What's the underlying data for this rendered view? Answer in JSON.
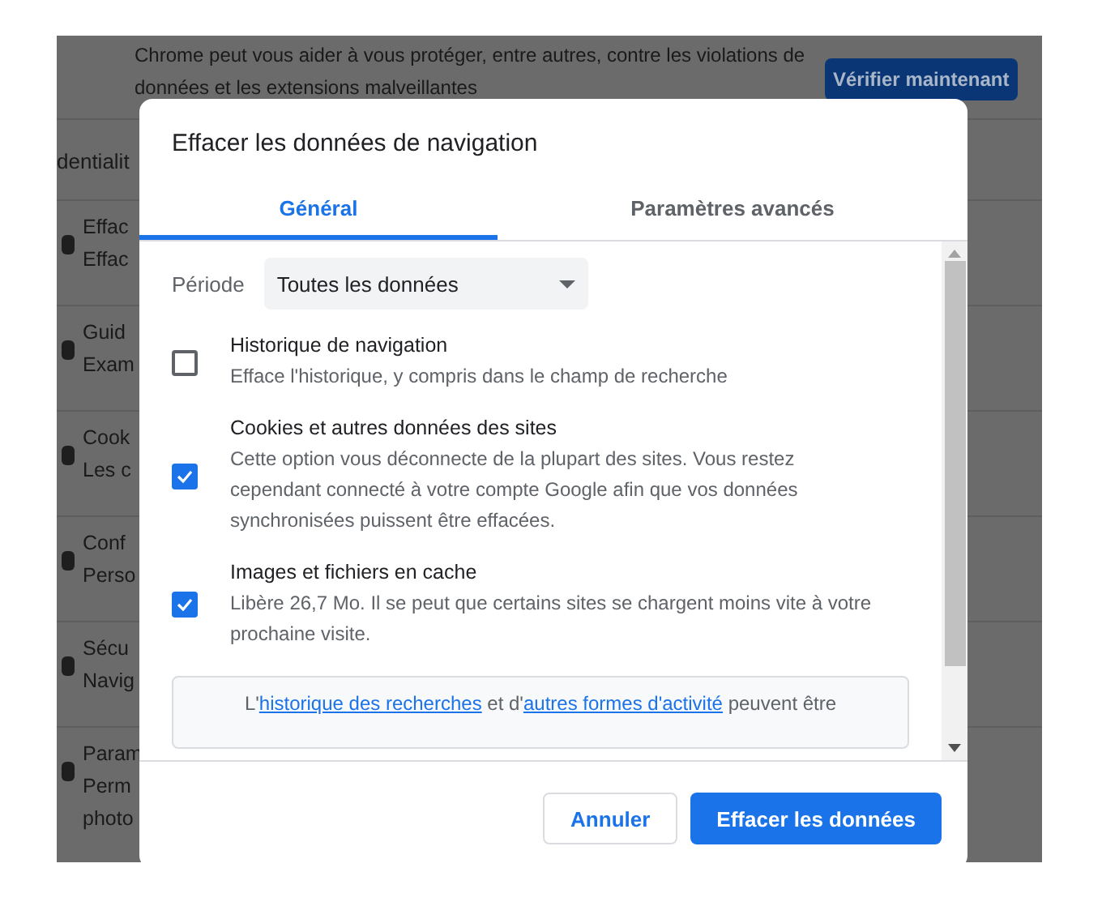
{
  "background": {
    "notice": [
      "Chrome peut vous aider à vous protéger, entre autres, contre les violations de",
      "données et les extensions malveillantes"
    ],
    "check_button": "Vérifier maintenant",
    "section_heading": "dentialit",
    "items": [
      {
        "title": "Effac",
        "subtitle": "Effac"
      },
      {
        "title": "Guid",
        "subtitle": "Exam"
      },
      {
        "title": "Cook",
        "subtitle": "Les c"
      },
      {
        "title": "Conf",
        "subtitle": "Perso"
      },
      {
        "title": "Sécu",
        "subtitle": "Navig"
      },
      {
        "title": "Param",
        "subtitle": "Perm",
        "extra": "photo"
      }
    ]
  },
  "dialog": {
    "title": "Effacer les données de navigation",
    "tabs": [
      {
        "label": "Général",
        "selected": true
      },
      {
        "label": "Paramètres avancés",
        "selected": false
      }
    ],
    "period": {
      "label": "Période",
      "value": "Toutes les données"
    },
    "options": [
      {
        "title": "Historique de navigation",
        "description": "Efface l'historique, y compris dans le champ de recherche",
        "checked": false
      },
      {
        "title": "Cookies et autres données des sites",
        "description": "Cette option vous déconnecte de la plupart des sites. Vous restez cependant connecté à votre compte Google afin que vos données synchronisées puissent être effacées.",
        "checked": true
      },
      {
        "title": "Images et fichiers en cache",
        "description": "Libère 26,7 Mo. Il se peut que certains sites se chargent moins vite à votre prochaine visite.",
        "checked": true
      }
    ],
    "notice": [
      {
        "kind": "text",
        "text": "L'"
      },
      {
        "kind": "link",
        "text": "historique des recherches"
      },
      {
        "kind": "text",
        "text": " et d'"
      },
      {
        "kind": "link",
        "text": "autres formes d'activité"
      },
      {
        "kind": "text",
        "text": " peuvent être"
      }
    ],
    "buttons": [
      {
        "label": "Annuler",
        "kind": "secondary"
      },
      {
        "label": "Effacer les données",
        "kind": "primary"
      }
    ]
  }
}
